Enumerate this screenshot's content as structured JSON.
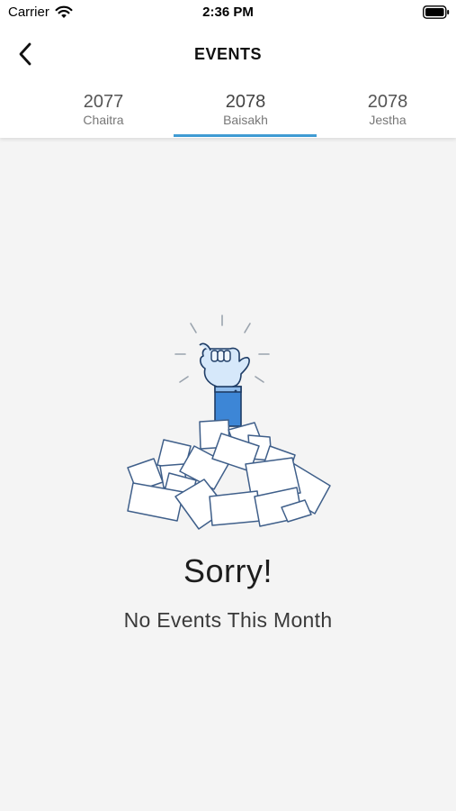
{
  "status_bar": {
    "carrier": "Carrier",
    "time": "2:36 PM",
    "wifi_icon": "wifi-icon",
    "battery_icon": "battery-icon"
  },
  "nav": {
    "title": "EVENTS",
    "back_icon": "chevron-left-icon"
  },
  "tabs": [
    {
      "year": "2077",
      "month": "Chaitra",
      "active": false
    },
    {
      "year": "2078",
      "month": "Baisakh",
      "active": true
    },
    {
      "year": "2078",
      "month": "Jestha",
      "active": false
    }
  ],
  "empty_state": {
    "title": "Sorry!",
    "subtitle": "No Events This Month",
    "illustration": "hand-in-paper-pile-illustration"
  },
  "colors": {
    "accent": "#3f9bd3",
    "sleeve": "#3d86d6",
    "background": "#f4f4f4",
    "header": "#ffffff"
  }
}
